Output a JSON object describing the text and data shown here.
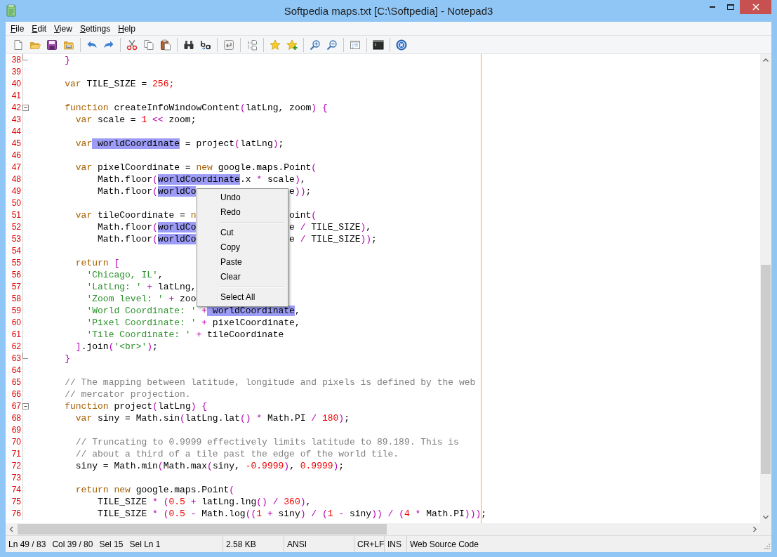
{
  "window": {
    "title": "Softpedia maps.txt [C:\\Softpedia] - Notepad3"
  },
  "menu_bar": {
    "items": [
      "File",
      "Edit",
      "View",
      "Settings",
      "Help"
    ]
  },
  "editor": {
    "lines": [
      {
        "number": "38",
        "fold_start": false,
        "fold_end": true,
        "tokens": [
          {
            "kind": "operator",
            "text": "    }"
          }
        ]
      },
      {
        "number": "39",
        "fold_start": false,
        "fold_end": false
      },
      {
        "number": "40",
        "fold_start": false,
        "fold_end": false,
        "tokens": [
          {
            "kind": "keyword",
            "text": "    var"
          },
          {
            "kind": "plain",
            "text": " TILE_SIZE = "
          },
          {
            "kind": "number",
            "text": "256;"
          }
        ]
      },
      {
        "number": "41",
        "fold_start": false,
        "fold_end": false
      },
      {
        "number": "42",
        "fold_start": true,
        "fold_end": false,
        "tokens": [
          {
            "kind": "keyword",
            "text": "    function"
          },
          {
            "kind": "plain",
            "text": " createInfoWindowContent"
          },
          {
            "kind": "operator",
            "text": "("
          },
          {
            "kind": "plain",
            "text": "latLng, zoom"
          },
          {
            "kind": "operator",
            "text": ") {"
          }
        ]
      },
      {
        "number": "43",
        "fold_start": false,
        "fold_end": false,
        "tokens": [
          {
            "kind": "keyword",
            "text": "      var"
          },
          {
            "kind": "plain",
            "text": " scale = "
          },
          {
            "kind": "number",
            "text": "1"
          },
          {
            "kind": "operator",
            "text": " <<"
          },
          {
            "kind": "plain",
            "text": " zoom;"
          }
        ]
      },
      {
        "number": "44",
        "fold_start": false,
        "fold_end": false
      },
      {
        "number": "45",
        "fold_start": false,
        "fold_end": false,
        "tokens": [
          {
            "kind": "keyword",
            "text": "      var"
          },
          {
            "kind": "match",
            "text": " worldCoordinate"
          },
          {
            "kind": "plain",
            "text": " = project"
          },
          {
            "kind": "operator",
            "text": "("
          },
          {
            "kind": "plain",
            "text": "latLng"
          },
          {
            "kind": "operator",
            "text": ")"
          },
          {
            "kind": "plain",
            "text": ";"
          }
        ]
      },
      {
        "number": "46",
        "fold_start": false,
        "fold_end": false
      },
      {
        "number": "47",
        "fold_start": false,
        "fold_end": false,
        "tokens": [
          {
            "kind": "keyword",
            "text": "      var"
          },
          {
            "kind": "plain",
            "text": " pixelCoordinate = "
          },
          {
            "kind": "keyword",
            "text": "new"
          },
          {
            "kind": "plain",
            "text": " google.maps.Point"
          },
          {
            "kind": "operator",
            "text": "("
          }
        ]
      },
      {
        "number": "48",
        "fold_start": false,
        "fold_end": false,
        "tokens": [
          {
            "kind": "plain",
            "text": "          Math.floor"
          },
          {
            "kind": "operator",
            "text": "("
          },
          {
            "kind": "match",
            "text": "worldCoordinate"
          },
          {
            "kind": "plain",
            "text": ".x "
          },
          {
            "kind": "operator",
            "text": "*"
          },
          {
            "kind": "plain",
            "text": " scale"
          },
          {
            "kind": "operator",
            "text": ")"
          },
          {
            "kind": "plain",
            "text": ","
          }
        ]
      },
      {
        "number": "49",
        "fold_start": false,
        "fold_end": false,
        "tokens": [
          {
            "kind": "plain",
            "text": "          Math.floor"
          },
          {
            "kind": "operator",
            "text": "("
          },
          {
            "kind": "match",
            "text": "worldCo"
          }
        ],
        "tokens_after_menu": [
          {
            "kind": "plain",
            "text": "e"
          },
          {
            "kind": "operator",
            "text": "))"
          },
          {
            "kind": "plain",
            "text": ";"
          }
        ]
      },
      {
        "number": "50",
        "fold_start": false,
        "fold_end": false
      },
      {
        "number": "51",
        "fold_start": false,
        "fold_end": false,
        "tokens": [
          {
            "kind": "keyword",
            "text": "      var"
          },
          {
            "kind": "plain",
            "text": " tileCoordinate = "
          },
          {
            "kind": "keyword",
            "text": "n"
          }
        ],
        "tokens_after_menu": [
          {
            "kind": "plain",
            "text": "oint"
          },
          {
            "kind": "operator",
            "text": "("
          }
        ]
      },
      {
        "number": "52",
        "fold_start": false,
        "fold_end": false,
        "tokens": [
          {
            "kind": "plain",
            "text": "          Math.floor"
          },
          {
            "kind": "operator",
            "text": "("
          },
          {
            "kind": "match",
            "text": "worldCo"
          }
        ],
        "tokens_after_menu": [
          {
            "kind": "plain",
            "text": "e "
          },
          {
            "kind": "operator",
            "text": "/"
          },
          {
            "kind": "plain",
            "text": " TILE_SIZE"
          },
          {
            "kind": "operator",
            "text": ")"
          },
          {
            "kind": "plain",
            "text": ","
          }
        ]
      },
      {
        "number": "53",
        "fold_start": false,
        "fold_end": false,
        "tokens": [
          {
            "kind": "plain",
            "text": "          Math.floor"
          },
          {
            "kind": "operator",
            "text": "("
          },
          {
            "kind": "match",
            "text": "worldCo"
          }
        ],
        "tokens_after_menu": [
          {
            "kind": "plain",
            "text": "e "
          },
          {
            "kind": "operator",
            "text": "/"
          },
          {
            "kind": "plain",
            "text": " TILE_SIZE"
          },
          {
            "kind": "operator",
            "text": "))"
          },
          {
            "kind": "plain",
            "text": ";"
          }
        ]
      },
      {
        "number": "54",
        "fold_start": false,
        "fold_end": false
      },
      {
        "number": "55",
        "fold_start": false,
        "fold_end": false,
        "tokens": [
          {
            "kind": "keyword",
            "text": "      return"
          },
          {
            "kind": "operator",
            "text": " ["
          }
        ]
      },
      {
        "number": "56",
        "fold_start": false,
        "fold_end": false,
        "tokens": [
          {
            "kind": "string",
            "text": "        'Chicago, IL'"
          },
          {
            "kind": "plain",
            "text": ","
          }
        ]
      },
      {
        "number": "57",
        "fold_start": false,
        "fold_end": false,
        "tokens": [
          {
            "kind": "string",
            "text": "        'LatLng: '"
          },
          {
            "kind": "operator",
            "text": " +"
          },
          {
            "kind": "plain",
            "text": " latLng,"
          }
        ]
      },
      {
        "number": "58",
        "fold_start": false,
        "fold_end": false,
        "tokens": [
          {
            "kind": "string",
            "text": "        'Zoom level: '"
          },
          {
            "kind": "operator",
            "text": " +"
          },
          {
            "kind": "plain",
            "text": " zoo"
          }
        ]
      },
      {
        "number": "59",
        "fold_start": false,
        "fold_end": false,
        "tokens": [
          {
            "kind": "string",
            "text": "        'World Coordinate: '"
          },
          {
            "kind": "operator",
            "text": " +"
          },
          {
            "kind": "match",
            "text": " worldCoordinate"
          },
          {
            "kind": "plain",
            "text": ","
          }
        ]
      },
      {
        "number": "60",
        "fold_start": false,
        "fold_end": false,
        "tokens": [
          {
            "kind": "string",
            "text": "        'Pixel Coordinate: '"
          },
          {
            "kind": "operator",
            "text": " +"
          },
          {
            "kind": "plain",
            "text": " pixelCoordinate,"
          }
        ]
      },
      {
        "number": "61",
        "fold_start": false,
        "fold_end": false,
        "tokens": [
          {
            "kind": "string",
            "text": "        'Tile Coordinate: '"
          },
          {
            "kind": "operator",
            "text": " +"
          },
          {
            "kind": "plain",
            "text": " tileCoordinate"
          }
        ]
      },
      {
        "number": "62",
        "fold_start": false,
        "fold_end": false,
        "tokens": [
          {
            "kind": "operator",
            "text": "      ]"
          },
          {
            "kind": "plain",
            "text": ".join"
          },
          {
            "kind": "operator",
            "text": "("
          },
          {
            "kind": "string",
            "text": "'<br>'"
          },
          {
            "kind": "operator",
            "text": ")"
          },
          {
            "kind": "plain",
            "text": ";"
          }
        ]
      },
      {
        "number": "63",
        "fold_start": false,
        "fold_end": true,
        "tokens": [
          {
            "kind": "operator",
            "text": "    }"
          }
        ]
      },
      {
        "number": "64",
        "fold_start": false,
        "fold_end": false
      },
      {
        "number": "65",
        "fold_start": false,
        "fold_end": false,
        "tokens": [
          {
            "kind": "comment",
            "text": "    // The mapping between latitude, longitude and pixels is defined by the web"
          }
        ]
      },
      {
        "number": "66",
        "fold_start": false,
        "fold_end": false,
        "tokens": [
          {
            "kind": "comment",
            "text": "    // mercator projection."
          }
        ]
      },
      {
        "number": "67",
        "fold_start": true,
        "fold_end": false,
        "tokens": [
          {
            "kind": "keyword",
            "text": "    function"
          },
          {
            "kind": "plain",
            "text": " project"
          },
          {
            "kind": "operator",
            "text": "("
          },
          {
            "kind": "plain",
            "text": "latLng"
          },
          {
            "kind": "operator",
            "text": ") {"
          }
        ]
      },
      {
        "number": "68",
        "fold_start": false,
        "fold_end": false,
        "tokens": [
          {
            "kind": "keyword",
            "text": "      var"
          },
          {
            "kind": "plain",
            "text": " siny = Math.sin"
          },
          {
            "kind": "operator",
            "text": "("
          },
          {
            "kind": "plain",
            "text": "latLng.lat"
          },
          {
            "kind": "operator",
            "text": "() *"
          },
          {
            "kind": "plain",
            "text": " Math.PI "
          },
          {
            "kind": "operator",
            "text": "/"
          },
          {
            "kind": "number",
            "text": " 180"
          },
          {
            "kind": "operator",
            "text": ")"
          },
          {
            "kind": "plain",
            "text": ";"
          }
        ]
      },
      {
        "number": "69",
        "fold_start": false,
        "fold_end": false
      },
      {
        "number": "70",
        "fold_start": false,
        "fold_end": false,
        "tokens": [
          {
            "kind": "comment",
            "text": "      // Truncating to 0.9999 effectively limits latitude to 89.189. This is"
          }
        ]
      },
      {
        "number": "71",
        "fold_start": false,
        "fold_end": false,
        "tokens": [
          {
            "kind": "comment",
            "text": "      // about a third of a tile past the edge of the world tile."
          }
        ]
      },
      {
        "number": "72",
        "fold_start": false,
        "fold_end": false,
        "tokens": [
          {
            "kind": "plain",
            "text": "      siny = Math.min"
          },
          {
            "kind": "operator",
            "text": "("
          },
          {
            "kind": "plain",
            "text": "Math.max"
          },
          {
            "kind": "operator",
            "text": "("
          },
          {
            "kind": "plain",
            "text": "siny, "
          },
          {
            "kind": "number",
            "text": "-0.9999"
          },
          {
            "kind": "operator",
            "text": ")"
          },
          {
            "kind": "plain",
            "text": ", "
          },
          {
            "kind": "number",
            "text": "0.9999"
          },
          {
            "kind": "operator",
            "text": ")"
          },
          {
            "kind": "plain",
            "text": ";"
          }
        ]
      },
      {
        "number": "73",
        "fold_start": false,
        "fold_end": false
      },
      {
        "number": "74",
        "fold_start": false,
        "fold_end": false,
        "tokens": [
          {
            "kind": "keyword",
            "text": "      return"
          },
          {
            "kind": "keyword",
            "text": " new"
          },
          {
            "kind": "plain",
            "text": " google.maps.Point"
          },
          {
            "kind": "operator",
            "text": "("
          }
        ]
      },
      {
        "number": "75",
        "fold_start": false,
        "fold_end": false,
        "tokens": [
          {
            "kind": "plain",
            "text": "          TILE_SIZE "
          },
          {
            "kind": "operator",
            "text": "* ("
          },
          {
            "kind": "number",
            "text": "0.5"
          },
          {
            "kind": "operator",
            "text": " +"
          },
          {
            "kind": "plain",
            "text": " latLng.lng"
          },
          {
            "kind": "operator",
            "text": "() /"
          },
          {
            "kind": "number",
            "text": " 360"
          },
          {
            "kind": "operator",
            "text": ")"
          },
          {
            "kind": "plain",
            "text": ","
          }
        ]
      },
      {
        "number": "76",
        "fold_start": false,
        "fold_end": false,
        "tokens": [
          {
            "kind": "plain",
            "text": "          TILE_SIZE "
          },
          {
            "kind": "operator",
            "text": "* ("
          },
          {
            "kind": "number",
            "text": "0.5"
          },
          {
            "kind": "operator",
            "text": " -"
          },
          {
            "kind": "plain",
            "text": " Math.log"
          },
          {
            "kind": "operator",
            "text": "(("
          },
          {
            "kind": "number",
            "text": "1"
          },
          {
            "kind": "operator",
            "text": " +"
          },
          {
            "kind": "plain",
            "text": " siny"
          },
          {
            "kind": "operator",
            "text": ") / ("
          },
          {
            "kind": "number",
            "text": "1"
          },
          {
            "kind": "operator",
            "text": " -"
          },
          {
            "kind": "plain",
            "text": " siny"
          },
          {
            "kind": "operator",
            "text": ")) / ("
          },
          {
            "kind": "number",
            "text": "4"
          },
          {
            "kind": "operator",
            "text": " *"
          },
          {
            "kind": "plain",
            "text": " Math.PI"
          },
          {
            "kind": "operator",
            "text": ")))"
          },
          {
            "kind": "plain",
            "text": ";"
          }
        ]
      }
    ]
  },
  "context_menu": {
    "items": [
      {
        "kind": "item",
        "label": "Undo"
      },
      {
        "kind": "item",
        "label": "Redo"
      },
      {
        "kind": "separator"
      },
      {
        "kind": "item",
        "label": "Cut"
      },
      {
        "kind": "item",
        "label": "Copy"
      },
      {
        "kind": "item",
        "label": "Paste"
      },
      {
        "kind": "item",
        "label": "Clear"
      },
      {
        "kind": "separator"
      },
      {
        "kind": "item",
        "label": "Select All"
      }
    ]
  },
  "status_bar": {
    "sections": [
      [
        "Ln 49 / 83",
        "Col 39 / 80",
        "Sel 15",
        "Sel Ln 1"
      ],
      [
        "2.58 KB"
      ],
      [
        "ANSI"
      ],
      [
        "CR+LF"
      ],
      [
        "INS"
      ],
      [
        "Web Source Code"
      ]
    ]
  }
}
